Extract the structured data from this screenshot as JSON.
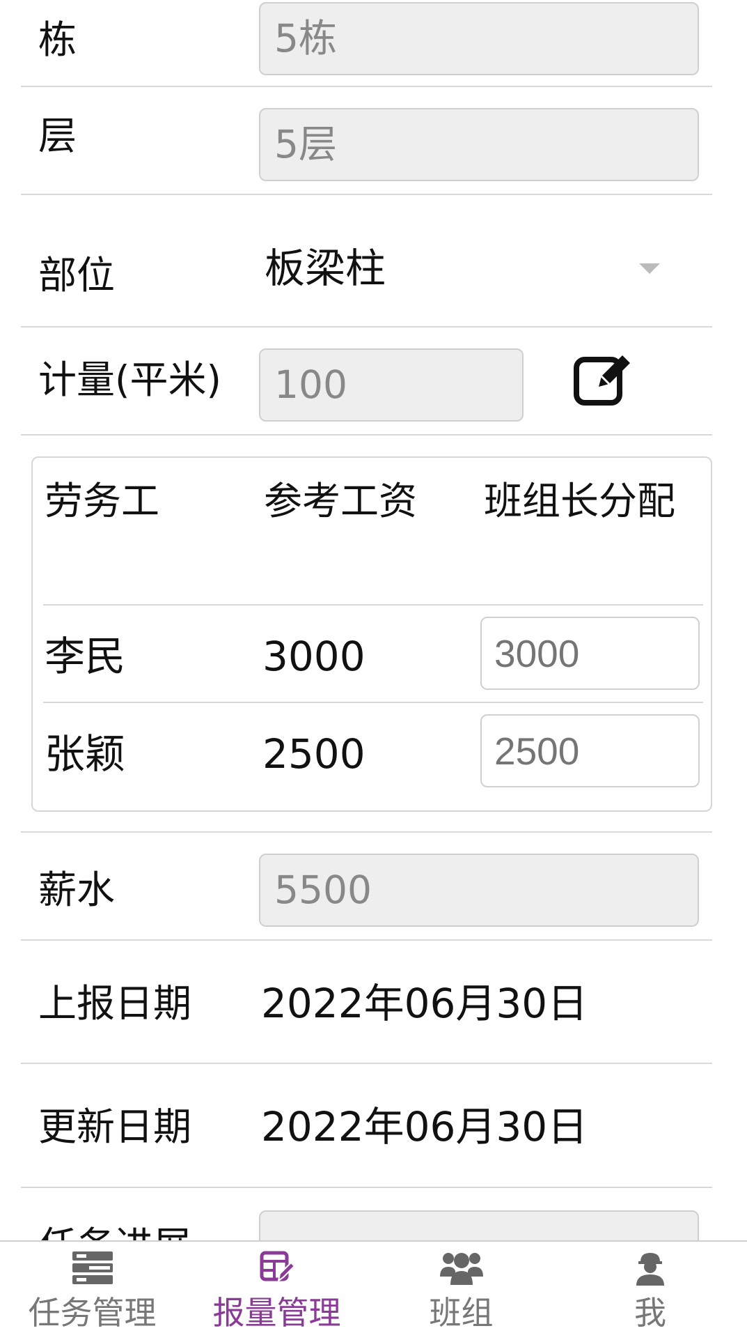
{
  "form": {
    "building": {
      "label": "栋",
      "value": "5栋"
    },
    "floor": {
      "label": "层",
      "value": "5层"
    },
    "part": {
      "label": "部位",
      "value": "板梁柱"
    },
    "measure": {
      "label": "计量(平米)",
      "value": "100"
    },
    "labor_table": {
      "headers": [
        "劳务工",
        "参考工资",
        "班组长分配"
      ],
      "rows": [
        {
          "name": "李民",
          "reference_wage": "3000",
          "allocation_placeholder": "3000"
        },
        {
          "name": "张颖",
          "reference_wage": "2500",
          "allocation_placeholder": "2500"
        }
      ]
    },
    "salary": {
      "label": "薪水",
      "value": "5500"
    },
    "report_date": {
      "label": "上报日期",
      "value": "2022年06月30日"
    },
    "update_date": {
      "label": "更新日期",
      "value": "2022年06月30日"
    },
    "progress": {
      "label": "任务进展"
    }
  },
  "tabbar": {
    "active_color": "#8a3b96",
    "items": [
      {
        "label": "任务管理",
        "icon": "server-stack-icon"
      },
      {
        "label": "报量管理",
        "icon": "form-edit-icon"
      },
      {
        "label": "班组",
        "icon": "team-icon"
      },
      {
        "label": "我",
        "icon": "worker-helmet-icon"
      }
    ]
  }
}
